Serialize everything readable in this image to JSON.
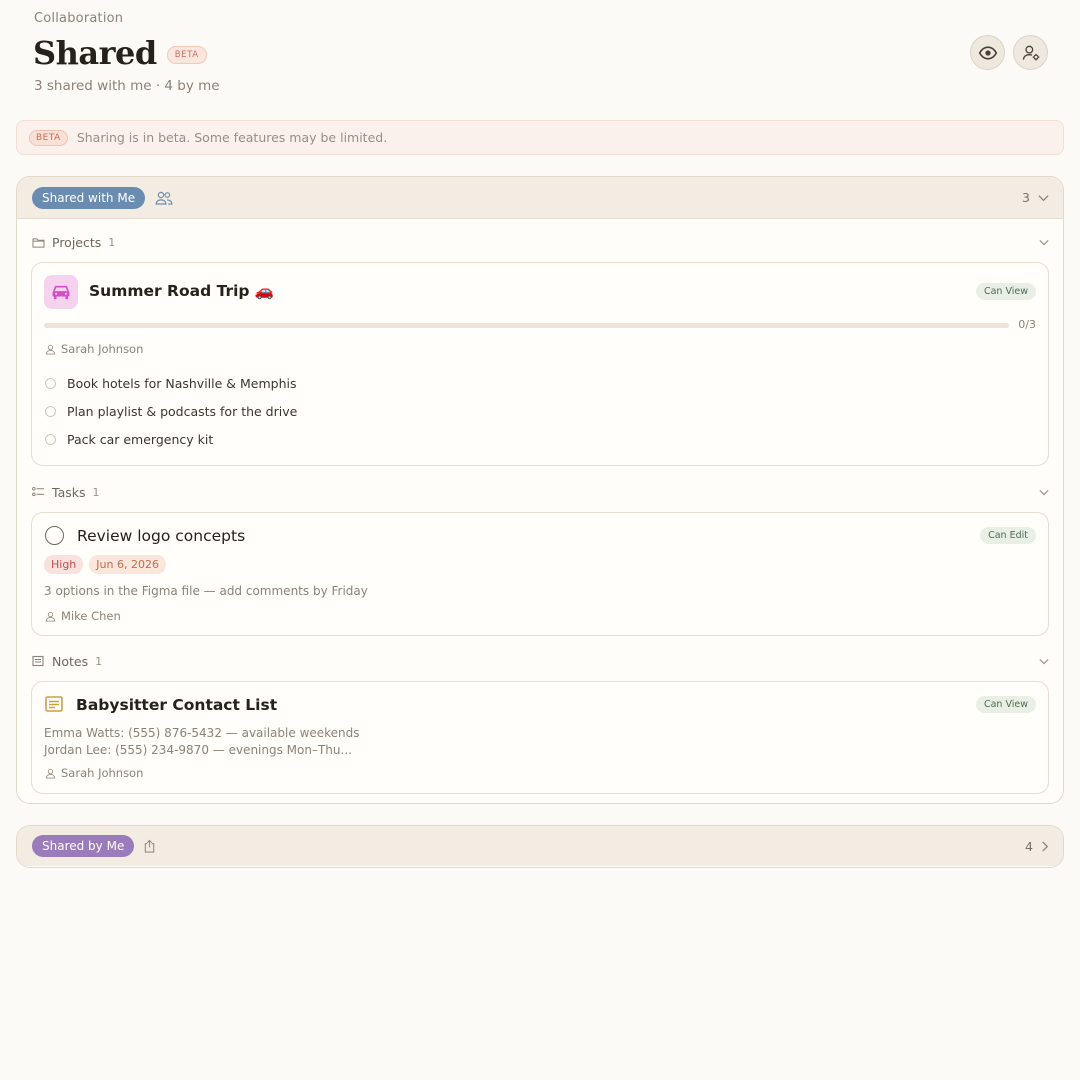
{
  "header": {
    "eyebrow": "Collaboration",
    "title": "Shared",
    "title_badge": "BETA",
    "subtitle": "3 shared with me · 4 by me",
    "actions": [
      {
        "icon": "eye-icon"
      },
      {
        "icon": "user-settings-icon"
      }
    ]
  },
  "banner": {
    "badge": "BETA",
    "text": "Sharing is in beta. Some features may be limited."
  },
  "shared_with_me": {
    "label": "Shared with Me",
    "count": "3",
    "groups": {
      "projects": {
        "label": "Projects",
        "count": "1",
        "item": {
          "title": "Summer Road Trip 🚗",
          "permission": "Can View",
          "progress_text": "0/3",
          "progress": 0,
          "owner": "Sarah Johnson",
          "checklist": [
            "Book hotels for Nashville & Memphis",
            "Plan playlist & podcasts for the drive",
            "Pack car emergency kit"
          ]
        }
      },
      "tasks": {
        "label": "Tasks",
        "count": "1",
        "item": {
          "title": "Review logo concepts",
          "permission": "Can Edit",
          "priority": "High",
          "due": "Jun 6, 2026",
          "description": "3 options in the Figma file — add comments by Friday",
          "owner": "Mike Chen"
        }
      },
      "notes": {
        "label": "Notes",
        "count": "1",
        "item": {
          "title": "Babysitter Contact List",
          "permission": "Can View",
          "line1": "Emma Watts: (555) 876-5432 — available weekends",
          "line2": "Jordan Lee: (555) 234-9870 — evenings Mon–Thu...",
          "owner": "Sarah Johnson"
        }
      }
    }
  },
  "shared_by_me": {
    "label": "Shared by Me",
    "count": "4"
  },
  "colors": {
    "background": "#fcfaf6",
    "shared_with_me_pill": "#6a8cb1",
    "shared_by_me_pill": "#9a7bbb",
    "permission_badge": "#e9efe5",
    "priority_high": "#c0504a"
  }
}
